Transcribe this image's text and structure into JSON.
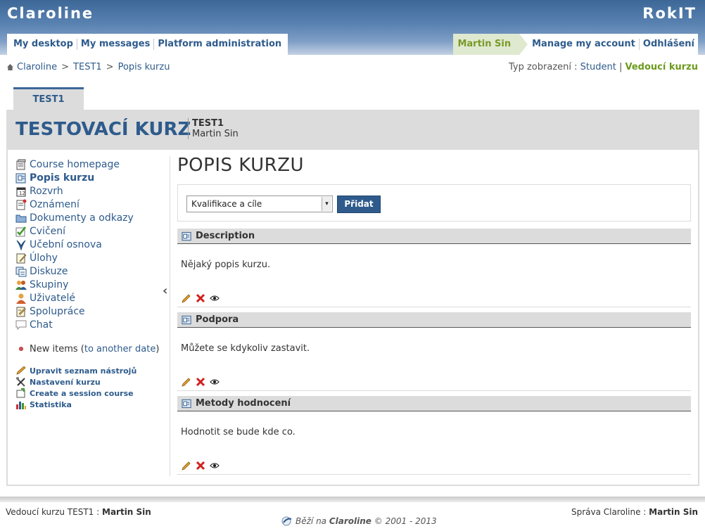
{
  "banner": {
    "site_name": "Claroline",
    "institution": "RokIT"
  },
  "main_tabs": [
    "My desktop",
    "My messages",
    "Platform administration"
  ],
  "user_bar": {
    "user_name": "Martin Sin",
    "manage_account": "Manage my account",
    "logout": "Odhlášení"
  },
  "breadcrumb": {
    "items": [
      "Claroline",
      "TEST1",
      "Popis kurzu"
    ],
    "separator": ">"
  },
  "view_mode": {
    "label": "Typ zobrazení :",
    "student": "Student",
    "separator": "|",
    "manager": "Vedoucí kurzu"
  },
  "course": {
    "tab_label": "TEST1",
    "title": "TESTOVACÍ KURZ",
    "code": "TEST1",
    "teacher": "Martin Sin"
  },
  "sidebar": {
    "tools": [
      {
        "label": "Course homepage",
        "icon": "course-homepage-icon"
      },
      {
        "label": "Popis kurzu",
        "icon": "description-icon",
        "active": true
      },
      {
        "label": "Rozvrh",
        "icon": "calendar-icon"
      },
      {
        "label": "Oznámení",
        "icon": "announcement-icon"
      },
      {
        "label": "Dokumenty a odkazy",
        "icon": "folder-icon"
      },
      {
        "label": "Cvičení",
        "icon": "checkmark-icon"
      },
      {
        "label": "Učební osnova",
        "icon": "learning-path-icon"
      },
      {
        "label": "Úlohy",
        "icon": "assignment-icon"
      },
      {
        "label": "Diskuze",
        "icon": "forum-icon"
      },
      {
        "label": "Skupiny",
        "icon": "groups-icon"
      },
      {
        "label": "Uživatelé",
        "icon": "users-icon"
      },
      {
        "label": "Spolupráce",
        "icon": "wiki-icon"
      },
      {
        "label": "Chat",
        "icon": "chat-icon"
      }
    ],
    "new_items_label": "New items (",
    "new_items_link": "to another date",
    "new_items_end": ")",
    "admin_links": [
      {
        "label": "Upravit seznam nástrojů",
        "icon": "pencil-icon"
      },
      {
        "label": "Nastavení kurzu",
        "icon": "tools-icon"
      },
      {
        "label": "Create a session course",
        "icon": "session-course-icon"
      },
      {
        "label": "Statistika",
        "icon": "statistics-icon"
      }
    ]
  },
  "content": {
    "page_title": "POPIS KURZU",
    "select_value": "Kvalifikace a cíle",
    "add_button": "Přidat",
    "sections": [
      {
        "title": "Description",
        "body": "Nějaký popis kurzu."
      },
      {
        "title": "Podpora",
        "body": "Můžete se kdykoliv zastavit."
      },
      {
        "title": "Metody hodnocení",
        "body": "Hodnotit se bude kde co."
      }
    ]
  },
  "footer": {
    "left_label": "Vedoucí kurzu TEST1 :",
    "left_name": "Martin Sin",
    "right_label": "Správa Claroline :",
    "right_name": "Martin Sin",
    "powered_prefix": "Běží na",
    "powered_name": "Claroline",
    "copyright": "© 2001 - 2013"
  },
  "colors": {
    "brand_blue": "#2e5b8c",
    "manager_green": "#6c9a1d",
    "header_gray": "#dcdcdc"
  }
}
